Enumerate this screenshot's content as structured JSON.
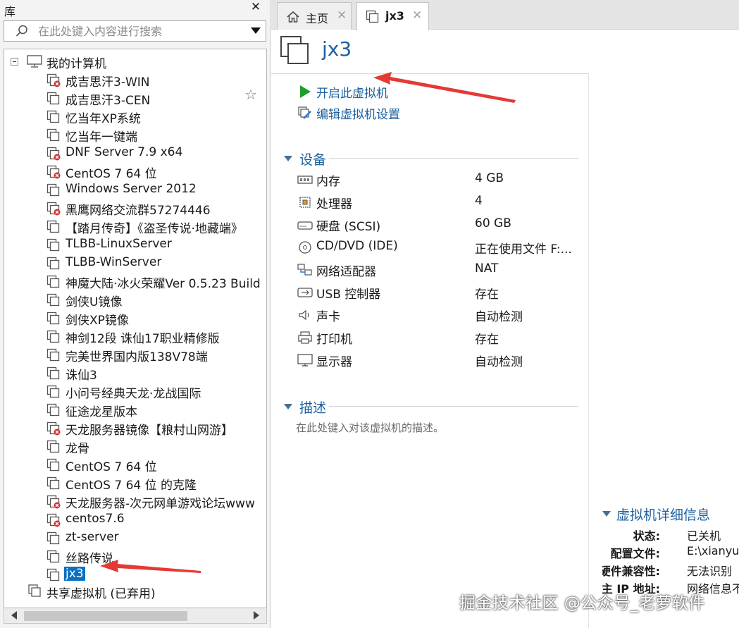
{
  "library": {
    "title": "库",
    "close_glyph": "✕",
    "search_placeholder": "在此处键入内容进行搜索",
    "root_label": "我的计算机",
    "vms": [
      {
        "label": "成吉思汗3-WIN",
        "error": true
      },
      {
        "label": "成吉思汗3-CEN",
        "error": false
      },
      {
        "label": "忆当年XP系统",
        "error": false
      },
      {
        "label": "忆当年一键端",
        "error": false
      },
      {
        "label": "DNF Server 7.9 x64",
        "error": true
      },
      {
        "label": "CentOS 7 64 位",
        "error": true
      },
      {
        "label": "Windows Server 2012",
        "error": false
      },
      {
        "label": "黑鹰网络交流群57274446",
        "error": true
      },
      {
        "label": "【踏月传奇】《盗圣传说·地藏端》",
        "error": false
      },
      {
        "label": "TLBB-LinuxServer",
        "error": false
      },
      {
        "label": "TLBB-WinServer",
        "error": false
      },
      {
        "label": "神魔大陆·冰火荣耀Ver 0.5.23 Build",
        "error": false
      },
      {
        "label": "剑侠U镜像",
        "error": false
      },
      {
        "label": "剑侠XP镜像",
        "error": false
      },
      {
        "label": "神剑12段 诛仙17职业精修版",
        "error": false
      },
      {
        "label": "完美世界国内版138V78端",
        "error": false
      },
      {
        "label": "诛仙3",
        "error": false
      },
      {
        "label": "小问号经典天龙·龙战国际",
        "error": false
      },
      {
        "label": "征途龙星版本",
        "error": false
      },
      {
        "label": "天龙服务器镜像【粮村山网游】",
        "error": true
      },
      {
        "label": "龙骨",
        "error": false
      },
      {
        "label": "CentOS 7 64 位",
        "error": false
      },
      {
        "label": "CentOS 7 64 位 的克隆",
        "error": false
      },
      {
        "label": "天龙服务器-次元网单游戏论坛www",
        "error": true
      },
      {
        "label": "centos7.6",
        "error": true
      },
      {
        "label": "zt-server",
        "error": false
      },
      {
        "label": "丝路传说",
        "error": false
      },
      {
        "label": "jx3",
        "error": false,
        "selected": true
      }
    ],
    "shared_label": "共享虚拟机 (已弃用)"
  },
  "tabs": [
    {
      "label": "主页",
      "icon": "home-icon"
    },
    {
      "label": "jx3",
      "icon": "vm-icon",
      "active": true
    }
  ],
  "vm": {
    "title": "jx3",
    "actions": {
      "power_on": "开启此虚拟机",
      "edit_settings": "编辑虚拟机设置"
    },
    "devices_title": "设备",
    "devices": [
      {
        "label": "内存",
        "value": "4 GB",
        "icon": "memory-icon"
      },
      {
        "label": "处理器",
        "value": "4",
        "icon": "cpu-icon"
      },
      {
        "label": "硬盘 (SCSI)",
        "value": "60 GB",
        "icon": "hard-disk-icon"
      },
      {
        "label": "CD/DVD (IDE)",
        "value": "正在使用文件 F:...",
        "icon": "cd-dvd-icon"
      },
      {
        "label": "网络适配器",
        "value": "NAT",
        "icon": "network-icon"
      },
      {
        "label": "USB 控制器",
        "value": "存在",
        "icon": "usb-icon"
      },
      {
        "label": "声卡",
        "value": "自动检测",
        "icon": "speaker-icon"
      },
      {
        "label": "打印机",
        "value": "存在",
        "icon": "printer-icon"
      },
      {
        "label": "显示器",
        "value": "自动检测",
        "icon": "monitor-icon"
      }
    ],
    "description_title": "描述",
    "description_placeholder": "在此处键入对该虚拟机的描述。",
    "details_title": "虚拟机详细信息",
    "details": [
      {
        "key": "状态:",
        "value": "已关机"
      },
      {
        "key": "配置文件:",
        "value": "E:\\xianyu"
      },
      {
        "key": "硬件兼容性:",
        "value": "无法识别"
      },
      {
        "key": "主 IP 地址:",
        "value": "网络信息不"
      }
    ]
  },
  "watermark": "掘金技术社区 @公众号_老萝软件",
  "colors": {
    "accent_blue": "#1d5f9e",
    "selection": "#0a6fc2",
    "error_red": "#d32f2f",
    "play_green": "#1e9e2f",
    "annotation_arrow": "#e53935"
  }
}
